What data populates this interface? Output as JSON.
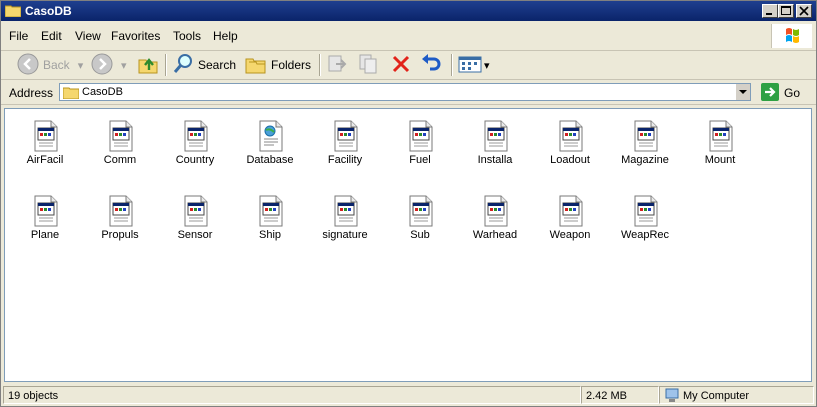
{
  "window": {
    "title": "CasoDB"
  },
  "menubar": {
    "items": [
      "File",
      "Edit",
      "View",
      "Favorites",
      "Tools",
      "Help"
    ]
  },
  "toolbar": {
    "back_label": "Back",
    "search_label": "Search",
    "folders_label": "Folders"
  },
  "address": {
    "label": "Address",
    "value": "CasoDB",
    "go_label": "Go"
  },
  "files": [
    {
      "name": "AirFacil",
      "icon": "document-icon"
    },
    {
      "name": "Comm",
      "icon": "document-icon"
    },
    {
      "name": "Country",
      "icon": "document-icon"
    },
    {
      "name": "Database",
      "icon": "web-document-icon"
    },
    {
      "name": "Facility",
      "icon": "document-icon"
    },
    {
      "name": "Fuel",
      "icon": "document-icon"
    },
    {
      "name": "Installa",
      "icon": "document-icon"
    },
    {
      "name": "Loadout",
      "icon": "document-icon"
    },
    {
      "name": "Magazine",
      "icon": "document-icon"
    },
    {
      "name": "Mount",
      "icon": "document-icon"
    },
    {
      "name": "Plane",
      "icon": "document-icon"
    },
    {
      "name": "Propuls",
      "icon": "document-icon"
    },
    {
      "name": "Sensor",
      "icon": "document-icon"
    },
    {
      "name": "Ship",
      "icon": "document-icon"
    },
    {
      "name": "signature",
      "icon": "document-icon"
    },
    {
      "name": "Sub",
      "icon": "document-icon"
    },
    {
      "name": "Warhead",
      "icon": "document-icon"
    },
    {
      "name": "Weapon",
      "icon": "document-icon"
    },
    {
      "name": "WeapRec",
      "icon": "document-icon"
    }
  ],
  "status": {
    "objects": "19 objects",
    "size": "2.42 MB",
    "zone": "My Computer"
  },
  "colors": {
    "titlebar": "#0a246a",
    "content_bg": "#ffffff",
    "chrome": "#ece9d8"
  }
}
